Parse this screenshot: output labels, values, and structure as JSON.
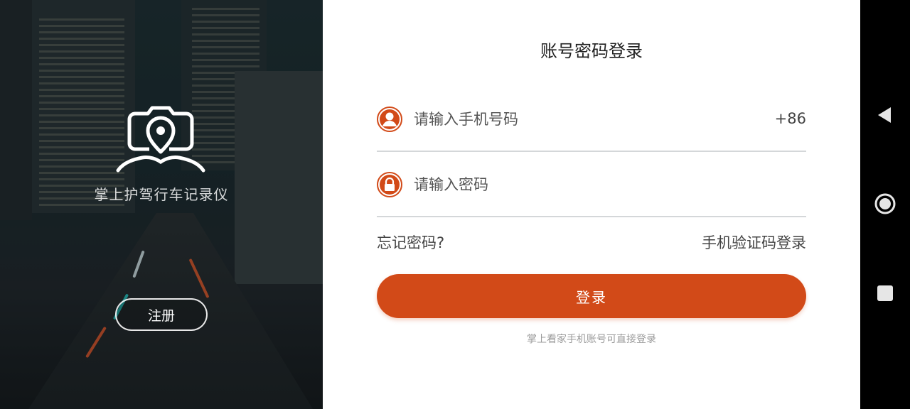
{
  "hero": {
    "app_name": "掌上护驾行车记录仪",
    "register_label": "注册",
    "logo_icon": "camera-location-car-icon"
  },
  "form": {
    "title": "账号密码登录",
    "phone": {
      "placeholder": "请输入手机号码",
      "value": "",
      "country_code": "+86",
      "icon": "user-avatar-icon"
    },
    "password": {
      "placeholder": "请输入密码",
      "value": "",
      "icon": "lock-icon"
    },
    "forgot_password": "忘记密码?",
    "sms_login": "手机验证码登录",
    "login_label": "登录",
    "hint": "掌上看家手机账号可直接登录"
  },
  "navbar": {
    "back_icon": "back-triangle-icon",
    "home_icon": "home-circle-icon",
    "recents_icon": "recents-square-icon"
  },
  "colors": {
    "accent": "#d24a18",
    "form_background": "#ffffff",
    "divider": "#d4d7d9",
    "navbar": "#000000"
  }
}
